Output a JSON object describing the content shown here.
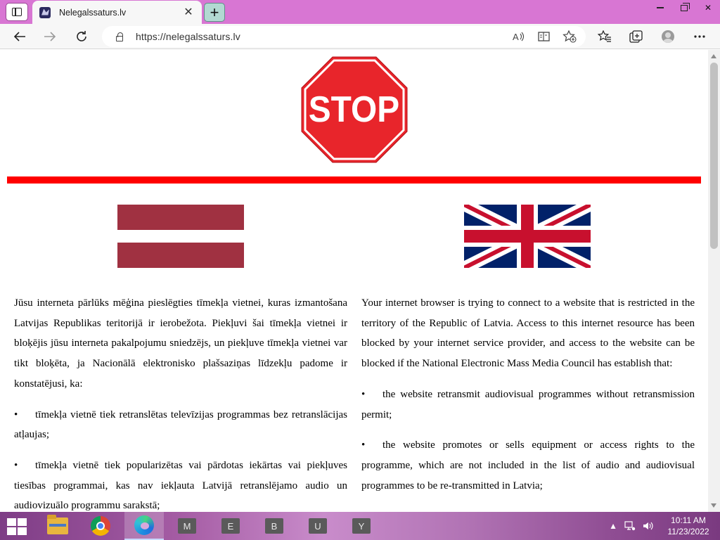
{
  "browser": {
    "tab": {
      "title": "Nelegalssaturs.lv",
      "close_glyph": "✕"
    },
    "new_tab_glyph": "+",
    "address": {
      "url": "https://nelegalssaturs.lv"
    },
    "window_controls": {
      "close_glyph": "✕"
    },
    "toolbar_icons": [
      "back-icon",
      "forward-icon",
      "refresh-icon",
      "lock-icon",
      "read-aloud-icon",
      "immersive-reader-icon",
      "add-favorite-icon",
      "favorites-icon",
      "collections-icon",
      "profile-icon",
      "more-icon"
    ]
  },
  "page": {
    "logo_text": "STOP",
    "bar_color": "#ff0000",
    "flags": [
      "latvia-flag",
      "uk-flag"
    ],
    "latvian": {
      "intro": "Jūsu interneta pārlūks mēģina pieslēgties tīmekļa vietnei, kuras izmantošana Latvijas Republikas teritorijā ir ierobežota. Piekļuvi šai tīmekļa vietnei ir bloķējis jūsu interneta pakalpojumu sniedzējs, un piekļuve tīmekļa vietnei var tikt bloķēta, ja Nacionālā elektronisko plašsaziņas līdzekļu padome ir konstatējusi, ka:",
      "bullet1": "tīmekļa vietnē tiek retranslētas televīzijas programmas bez retranslācijas atļaujas;",
      "bullet2": "tīmekļa vietnē tiek popularizētas vai pārdotas iekārtas vai piekļuves tiesības programmai, kas nav iekļauta Latvijā retranslējamo audio un audiovizuālo programmu sarakstā;"
    },
    "english": {
      "intro": "Your internet browser is trying to connect to a website that is restricted in the territory of the Republic of Latvia. Access to this internet resource has been blocked by your internet service provider, and access to the website can be blocked if the National Electronic Mass Media Council has establish that:",
      "bullet1": "the website retransmit audiovisual programmes without retransmission permit;",
      "bullet2": "the website promotes or sells equipment or access rights to the programme, which are not included in the list of audio and audiovisual programmes to be re-transmitted in Latvia;"
    },
    "bullet_glyph": "•"
  },
  "taskbar": {
    "apps": [
      {
        "name": "file-explorer"
      },
      {
        "name": "chrome"
      },
      {
        "name": "edge",
        "active": true
      },
      {
        "name": "M",
        "label": "M"
      },
      {
        "name": "E",
        "label": "E"
      },
      {
        "name": "B",
        "label": "B"
      },
      {
        "name": "U",
        "label": "U"
      },
      {
        "name": "Y",
        "label": "Y"
      }
    ],
    "clock": {
      "time": "10:11 AM",
      "date": "11/23/2022"
    },
    "tray_icons": [
      "chevron-up-icon",
      "network-icon",
      "volume-icon"
    ]
  }
}
